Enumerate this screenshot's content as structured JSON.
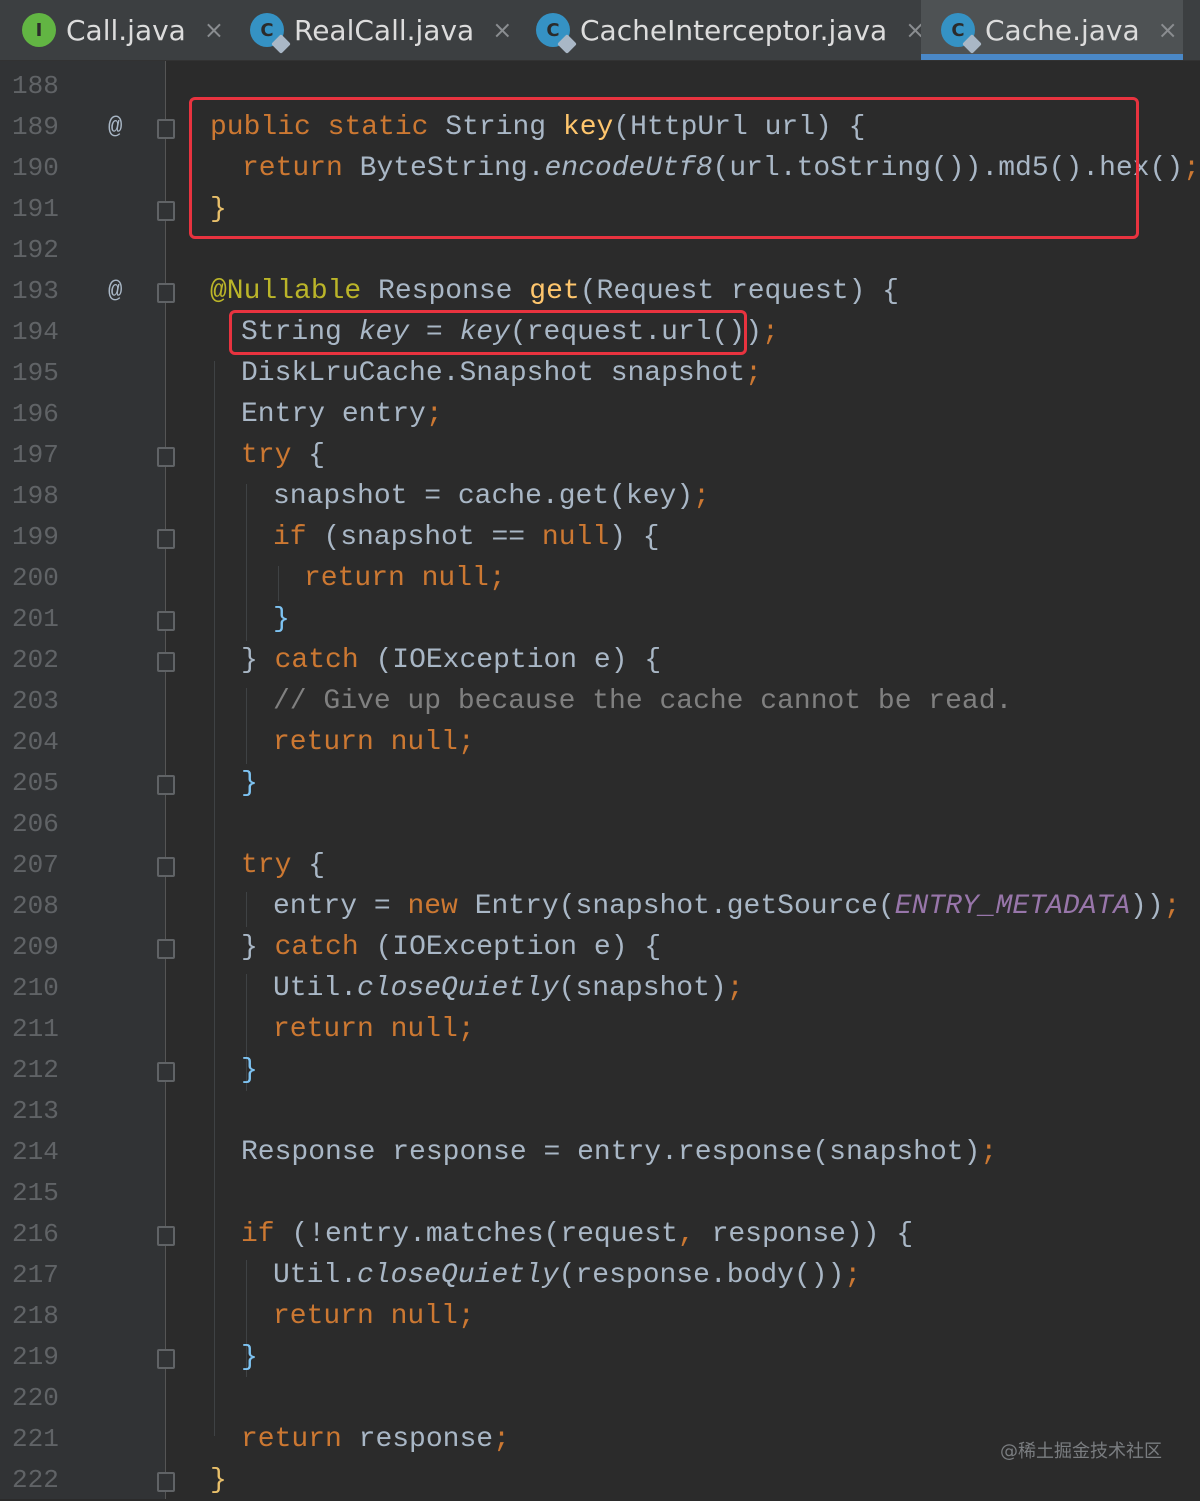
{
  "tabs": [
    {
      "label": "Call.java",
      "icon": "interface-icon",
      "active": false
    },
    {
      "label": "RealCall.java",
      "icon": "class-icon",
      "active": false
    },
    {
      "label": "CacheInterceptor.java",
      "icon": "class-icon",
      "active": false
    },
    {
      "label": "Cache.java",
      "icon": "class-icon",
      "active": true
    }
  ],
  "tab_close_glyph": "×",
  "gutter_marker": "@",
  "interface_letter": "I",
  "class_letter": "C",
  "line_numbers": [
    "188",
    "189",
    "190",
    "191",
    "192",
    "193",
    "194",
    "195",
    "196",
    "197",
    "198",
    "199",
    "200",
    "201",
    "202",
    "203",
    "204",
    "205",
    "206",
    "207",
    "208",
    "209",
    "210",
    "211",
    "212",
    "213",
    "214",
    "215",
    "216",
    "217",
    "218",
    "219",
    "220",
    "221",
    "222"
  ],
  "code": {
    "l189": "public static String key(HttpUrl url) {",
    "l190": "return ByteString.encodeUtf8(url.toString()).md5().hex();",
    "l191": "}",
    "l193": "@Nullable Response get(Request request) {",
    "l194": "String key = key(request.url());",
    "l195": "DiskLruCache.Snapshot snapshot;",
    "l196": "Entry entry;",
    "l197": "try {",
    "l198": "snapshot = cache.get(key);",
    "l199": "if (snapshot == null) {",
    "l200": "return null;",
    "l201": "}",
    "l202": "} catch (IOException e) {",
    "l203": "// Give up because the cache cannot be read.",
    "l204": "return null;",
    "l205": "}",
    "l207": "try {",
    "l208": "entry = new Entry(snapshot.getSource(ENTRY_METADATA));",
    "l209": "} catch (IOException e) {",
    "l210": "Util.closeQuietly(snapshot);",
    "l211": "return null;",
    "l212": "}",
    "l214": "Response response = entry.response(snapshot);",
    "l216": "if (!entry.matches(request, response)) {",
    "l217": "Util.closeQuietly(response.body());",
    "l218": "return null;",
    "l219": "}",
    "l221": "return response;",
    "l222": "}"
  },
  "watermark": "@稀土掘金技术社区",
  "colors": {
    "background": "#2b2b2b",
    "keyword": "#cc7832",
    "method": "#ffc66d",
    "text": "#a9b7c6",
    "comment": "#808080",
    "annotation": "#bbb529",
    "constant": "#9876aa",
    "highlight_box": "#e8333f",
    "active_tab_underline": "#4a88c7"
  }
}
